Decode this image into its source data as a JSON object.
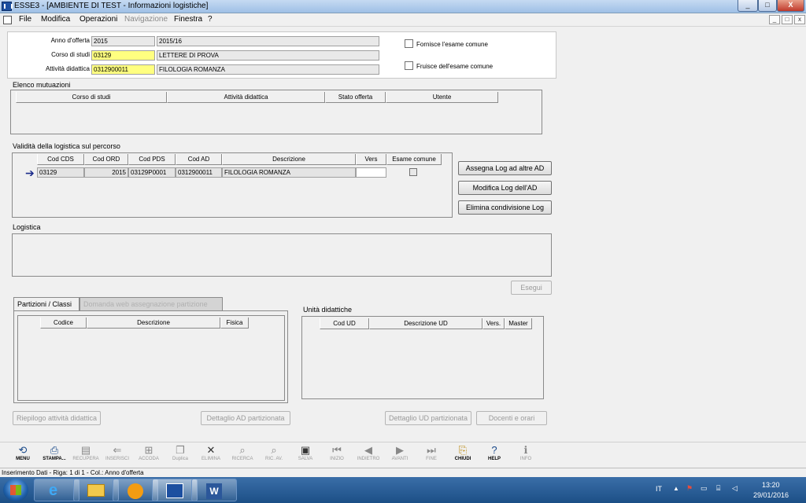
{
  "window": {
    "title": "ESSE3 - [AMBIENTE DI TEST - Informazioni logistiche]",
    "buttons": [
      "_",
      "□",
      "X"
    ],
    "mdi_buttons": [
      "_",
      "□",
      "x"
    ]
  },
  "menu": [
    "File",
    "Modifica",
    "Operazioni",
    "Navigazione",
    "Finestra",
    "?"
  ],
  "header": {
    "anno_label": "Anno d'offerta",
    "anno_value": "2015",
    "anno_desc": "2015/16",
    "corso_label": "Corso di studi",
    "corso_value": "03129",
    "corso_desc": "LETTERE DI PROVA",
    "attivita_label": "Attività didattica",
    "attivita_value": "0312900011",
    "attivita_desc": "FILOLOGIA ROMANZA",
    "fornisce_label": "Fornisce l'esame comune",
    "fruisce_label": "Fruisce dell'esame comune"
  },
  "mutuazioni": {
    "title": "Elenco mutuazioni",
    "columns": [
      "Corso di studi",
      "Attività didattica",
      "Stato offerta",
      "Utente"
    ]
  },
  "validita": {
    "title": "Validità della logistica sul percorso",
    "columns": [
      "Cod CDS",
      "Cod ORD",
      "Cod PDS",
      "Cod AD",
      "Descrizione",
      "Vers",
      "Esame comune"
    ],
    "row": {
      "cds": "03129",
      "ord": "2015",
      "pds": "03129P0001",
      "ad": "0312900011",
      "desc": "FILOLOGIA ROMANZA",
      "vers": ""
    },
    "buttons": [
      "Assegna Log ad altre AD",
      "Modifica Log dell'AD",
      "Elimina condivisione Log"
    ]
  },
  "logistica": {
    "title": "Logistica",
    "esegui": "Esegui"
  },
  "partizioni": {
    "tab_active": "Partizioni / Classi",
    "tab_inactive": "Domanda web assegnazione partizione",
    "columns": [
      "Codice",
      "Descrizione",
      "Fisica"
    ]
  },
  "unita": {
    "title": "Unità didattiche",
    "columns": [
      "Cod UD",
      "Descrizione UD",
      "Vers.",
      "Master"
    ]
  },
  "bottom_buttons": [
    "Riepilogo attività didattica",
    "Dettaglio AD partizionata",
    "Dettaglio UD partizionata",
    "Docenti e orari"
  ],
  "toolbar": [
    {
      "label": "MENU",
      "icon": "⟲",
      "enabled": true
    },
    {
      "label": "STAMPA...",
      "icon": "⎙",
      "enabled": true
    },
    {
      "label": "RECUPERA",
      "icon": "▤",
      "enabled": false
    },
    {
      "label": "INSERISCI",
      "icon": "⇐",
      "enabled": false
    },
    {
      "label": "ACCODA",
      "icon": "⊞",
      "enabled": false
    },
    {
      "label": "Duplica",
      "icon": "❐",
      "enabled": false
    },
    {
      "label": "ELIMINA",
      "icon": "✕",
      "enabled": false
    },
    {
      "label": "RICERCA",
      "icon": "⌕",
      "enabled": false
    },
    {
      "label": "RIC. AV.",
      "icon": "⌕",
      "enabled": false
    },
    {
      "label": "SALVA",
      "icon": "▣",
      "enabled": false
    },
    {
      "label": "INIZIO",
      "icon": "⏮",
      "enabled": false
    },
    {
      "label": "INDIETRO",
      "icon": "◀",
      "enabled": false
    },
    {
      "label": "AVANTI",
      "icon": "▶",
      "enabled": false
    },
    {
      "label": "FINE",
      "icon": "⏭",
      "enabled": false
    },
    {
      "label": "CHIUDI",
      "icon": "⎘",
      "enabled": true
    },
    {
      "label": "HELP",
      "icon": "?",
      "enabled": true
    },
    {
      "label": "INFO",
      "icon": "ℹ",
      "enabled": false
    }
  ],
  "status": "Inserimento Dati - Riga: 1 di 1 - Col.: Anno d'offerta",
  "taskbar": {
    "lang": "IT",
    "time": "13:20",
    "date": "29/01/2016"
  }
}
